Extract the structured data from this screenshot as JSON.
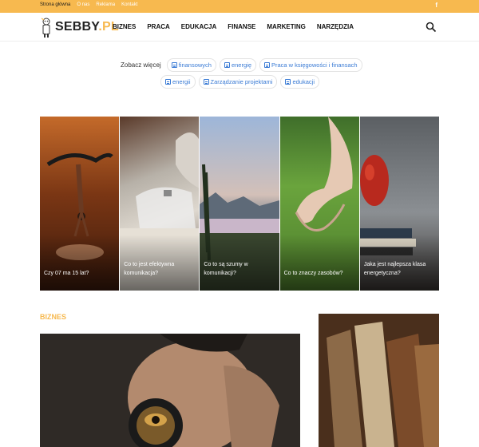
{
  "topbar": {
    "links": [
      "Strona główna",
      "O nas",
      "Reklama",
      "Kontakt"
    ],
    "social_icon": "facebook-icon"
  },
  "header": {
    "logo_text_main": "SEBBY",
    "logo_text_tld": ".PL",
    "nav": [
      "BIZNES",
      "PRACA",
      "EDUKACJA",
      "FINANSE",
      "MARKETING",
      "NARZĘDZIA"
    ],
    "search_icon": "search-icon"
  },
  "see_more": {
    "label": "Zobacz więcej",
    "tags": [
      "finansowych",
      "energię",
      "Praca w księgowości i finansach",
      "energii",
      "Zarządzanie projektami",
      "edukacji"
    ]
  },
  "gallery": [
    {
      "caption": "Czy 07 ma 15 lat?"
    },
    {
      "caption": "Co to jest efektywna komunikacja?"
    },
    {
      "caption": "Co to są szumy w komunikacji?"
    },
    {
      "caption": "Co to znaczy zasobów?"
    },
    {
      "caption": "Jaka jest najlepsza klasa energetyczna?"
    }
  ],
  "section": {
    "title": "BIZNES"
  },
  "colors": {
    "accent": "#f7b94f",
    "link": "#3a7bd5"
  }
}
